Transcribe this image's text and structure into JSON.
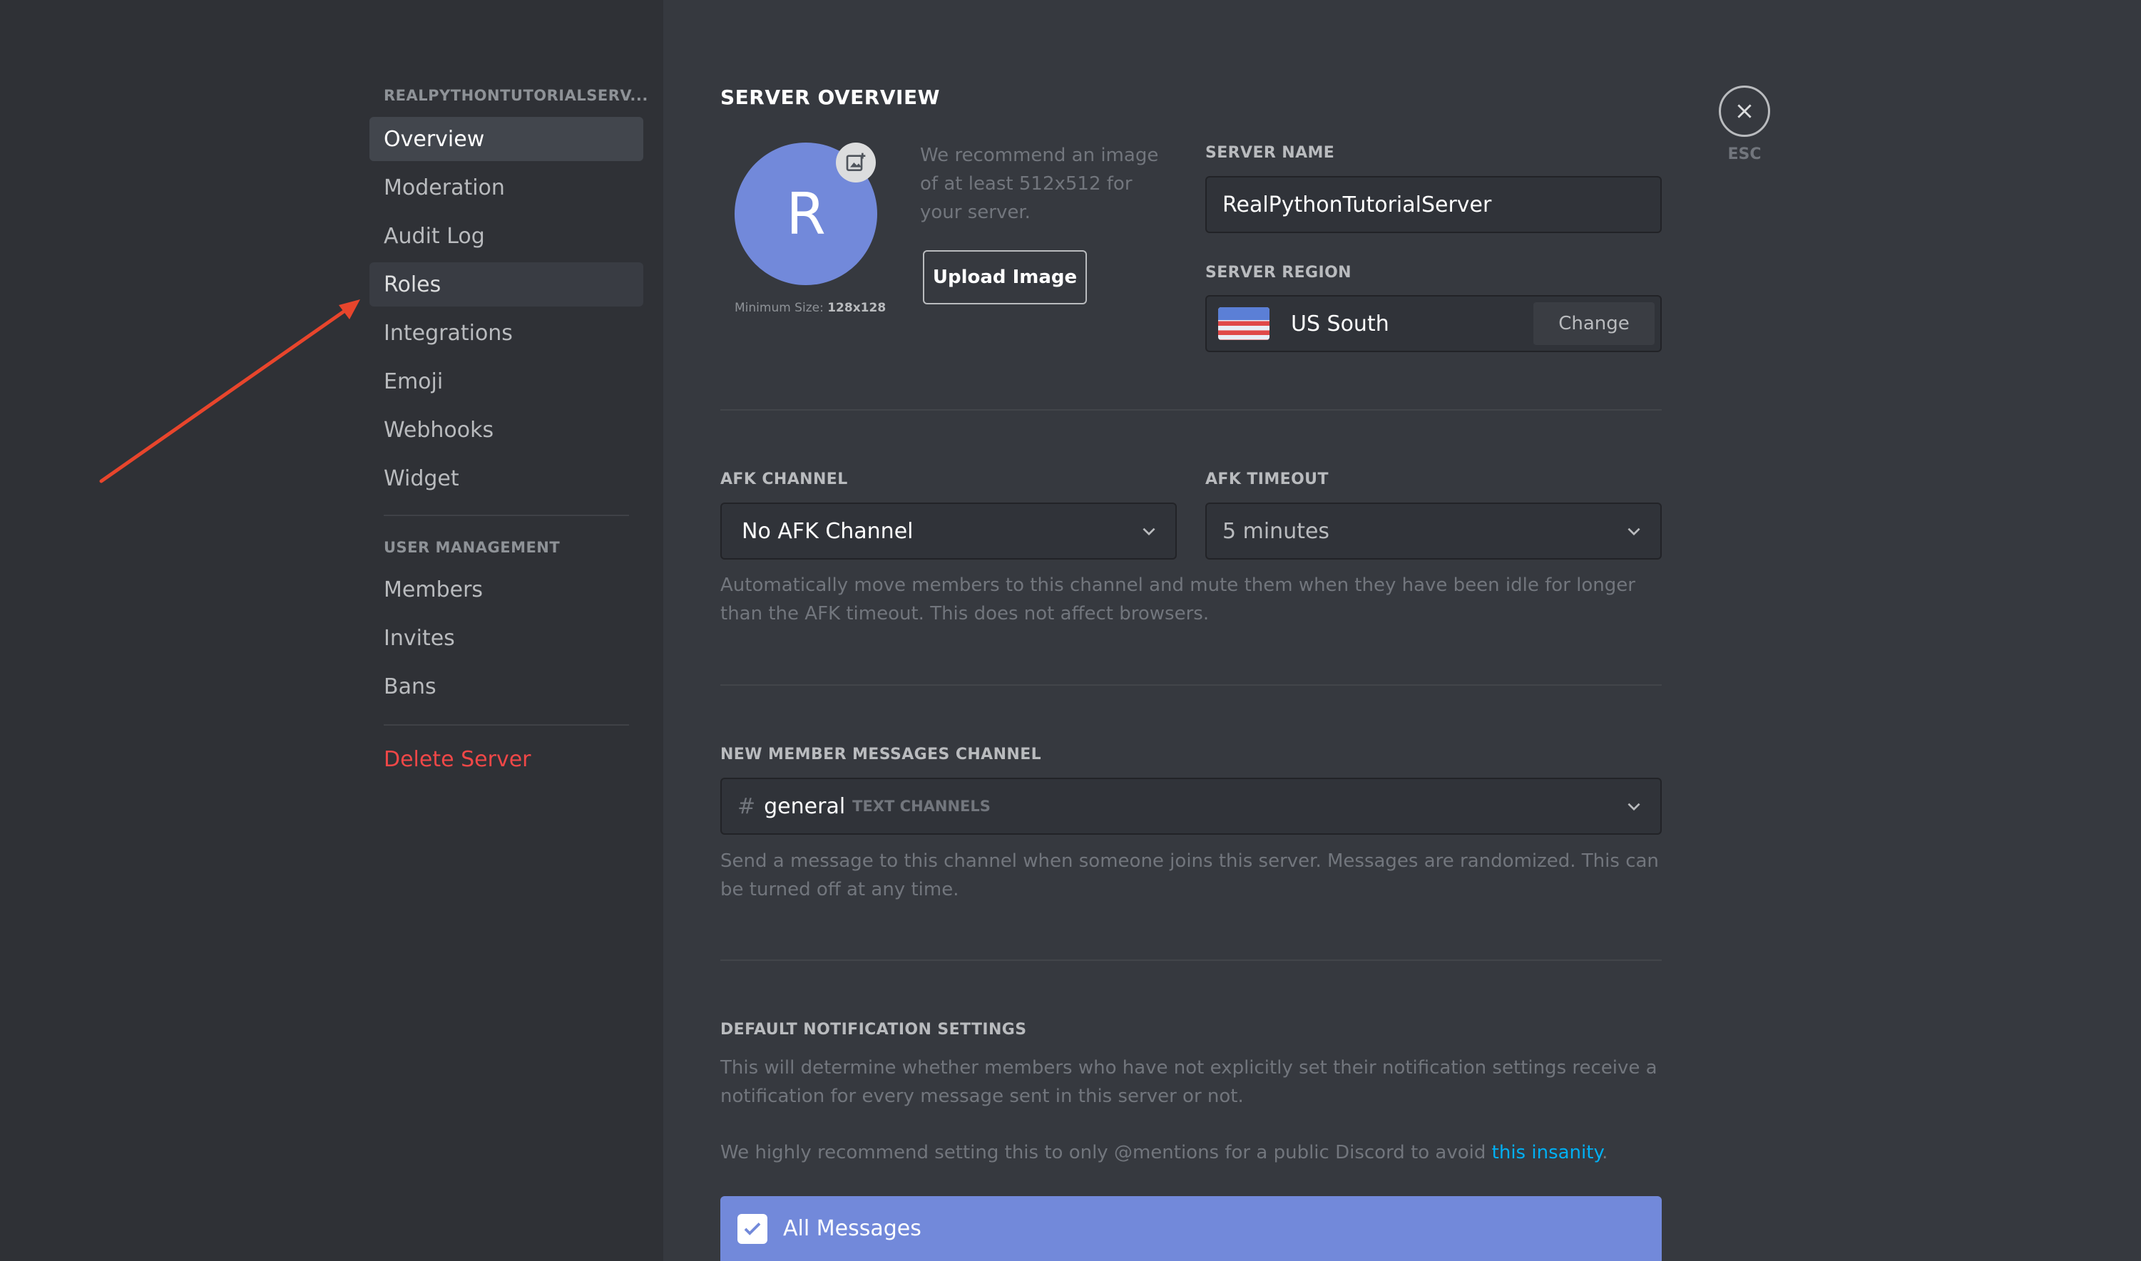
{
  "sidebar": {
    "server_header": "REALPYTHONTUTORIALSERV...",
    "items": [
      {
        "label": "Overview"
      },
      {
        "label": "Moderation"
      },
      {
        "label": "Audit Log"
      },
      {
        "label": "Roles"
      },
      {
        "label": "Integrations"
      },
      {
        "label": "Emoji"
      },
      {
        "label": "Webhooks"
      },
      {
        "label": "Widget"
      }
    ],
    "user_management_header": "USER MANAGEMENT",
    "user_items": [
      {
        "label": "Members"
      },
      {
        "label": "Invites"
      },
      {
        "label": "Bans"
      }
    ],
    "delete_label": "Delete Server",
    "colors": {
      "danger": "#f04747",
      "selected_bg": "#42464d"
    }
  },
  "annotation": {
    "arrow_color": "#e8452c",
    "points_to": "Roles"
  },
  "overview": {
    "title": "SERVER OVERVIEW",
    "avatar_initial": "R",
    "image_hint": "We recommend an image of at least 512x512 for your server.",
    "min_size_prefix": "Minimum Size: ",
    "min_size_value": "128x128",
    "upload_label": "Upload Image",
    "server_name_label": "SERVER NAME",
    "server_name_value": "RealPythonTutorialServer",
    "server_region_label": "SERVER REGION",
    "server_region_value": "US South",
    "change_label": "Change"
  },
  "afk": {
    "channel_label": "AFK CHANNEL",
    "channel_value": "No AFK Channel",
    "timeout_label": "AFK TIMEOUT",
    "timeout_value": "5 minutes",
    "hint": "Automatically move members to this channel and mute them when they have been idle for longer than the AFK timeout. This does not affect browsers."
  },
  "new_member": {
    "label": "NEW MEMBER MESSAGES CHANNEL",
    "hash": "#",
    "channel": "general",
    "category": "TEXT CHANNELS",
    "hint": "Send a message to this channel when someone joins this server. Messages are randomized. This can be turned off at any time."
  },
  "notifications": {
    "label": "DEFAULT NOTIFICATION SETTINGS",
    "hint1": "This will determine whether members who have not explicitly set their notification settings receive a notification for every message sent in this server or not.",
    "hint2_prefix": "We highly recommend setting this to only @mentions for a public Discord to avoid ",
    "hint2_link": "this insanity",
    "hint2_suffix": ".",
    "all_messages_label": "All Messages",
    "accent": "#7289da"
  },
  "close": {
    "esc_label": "ESC"
  }
}
